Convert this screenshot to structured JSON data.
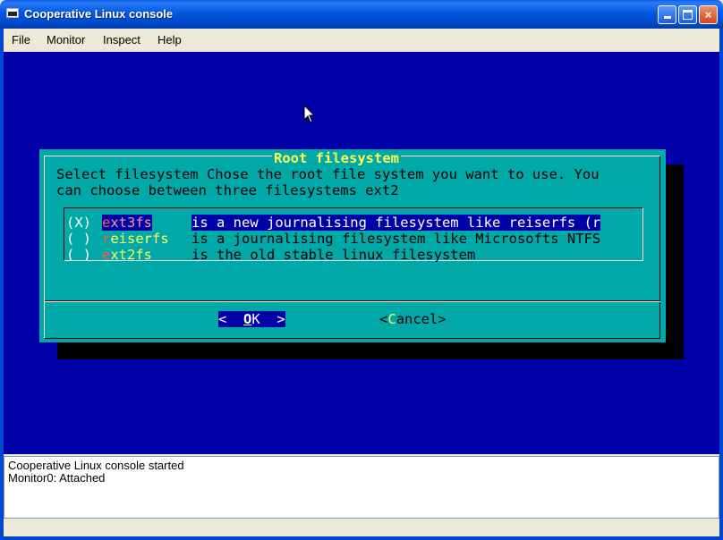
{
  "window": {
    "title": "Cooperative Linux console",
    "controls": {
      "minimize": "minimize",
      "maximize": "maximize",
      "close": "×"
    }
  },
  "menu": [
    "File",
    "Monitor",
    "Inspect",
    "Help"
  ],
  "dialog": {
    "title": "Root filesystem",
    "description_lines": [
      "Select filesystem Chose the root file system you want to use. You",
      "can choose between three filesystems ext2"
    ],
    "options": [
      {
        "mark": "(X)",
        "tag_first": "e",
        "tag_rest": "xt3fs",
        "description": "is a new journalising filesystem like reiserfs (r",
        "selected": true
      },
      {
        "mark": "( )",
        "tag_first": "r",
        "tag_rest": "eiserfs",
        "description": "is a journalising filesystem like Microsofts NTFS",
        "selected": false
      },
      {
        "mark": "( )",
        "tag_first": "e",
        "tag_rest": "xt2fs",
        "description": "is the old stable linux filesystem",
        "selected": false
      }
    ],
    "buttons": {
      "ok": {
        "left": "<  ",
        "hot": "O",
        "rest": "K  >"
      },
      "cancel": {
        "left": "<",
        "hot": "C",
        "rest": "ancel>"
      }
    }
  },
  "log": [
    "Cooperative Linux console started",
    "Monitor0: Attached"
  ],
  "colors": {
    "console_bg": "#0000a8",
    "dialog_bg": "#00a8a8",
    "title_yellow": "#ffff54",
    "hotkey_red": "#ff5555"
  }
}
